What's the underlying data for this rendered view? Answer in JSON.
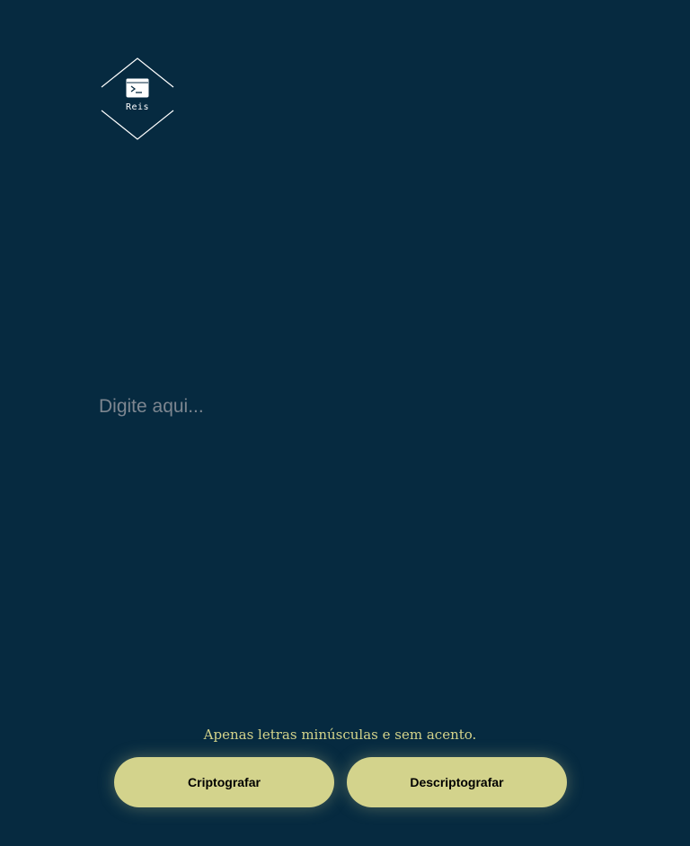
{
  "logo": {
    "text": "Reis",
    "icon": "terminal-icon"
  },
  "input": {
    "placeholder": "Digite aqui...",
    "value": ""
  },
  "hint": "Apenas letras minúsculas e sem acento.",
  "buttons": {
    "encrypt_label": "Criptografar",
    "decrypt_label": "Descriptografar"
  },
  "colors": {
    "background": "#062a40",
    "accent": "#d3d38c",
    "hint_text": "#d3d38a",
    "logo_stroke": "#ffffff"
  }
}
